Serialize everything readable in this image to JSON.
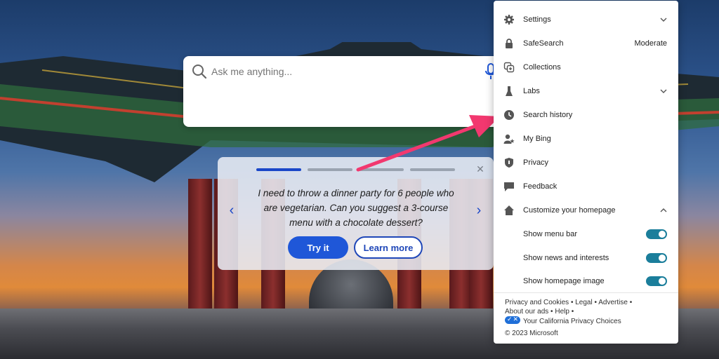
{
  "colors": {
    "accent": "#1f57d8",
    "toggle_on": "#1b7e9b",
    "arrow": "#f2386f"
  },
  "search": {
    "placeholder": "Ask me anything...",
    "icon": "search-icon",
    "mic_icon": "microphone-icon"
  },
  "suggestion": {
    "slides": 4,
    "active_slide": 1,
    "message": "I need to throw a dinner party for 6 people who are vegetarian. Can you suggest a 3-course menu with a chocolate dessert?",
    "try_label": "Try it",
    "learn_label": "Learn more",
    "prev_icon": "chevron-left-icon",
    "next_icon": "chevron-right-icon",
    "close_icon": "close-icon"
  },
  "menu": {
    "items": [
      {
        "label": "Settings",
        "icon": "gear-icon",
        "chevron": "down"
      },
      {
        "label": "SafeSearch",
        "icon": "lock-icon",
        "value": "Moderate"
      },
      {
        "label": "Collections",
        "icon": "collections-icon"
      },
      {
        "label": "Labs",
        "icon": "labs-icon",
        "chevron": "down"
      },
      {
        "label": "Search history",
        "icon": "clock-icon"
      },
      {
        "label": "My Bing",
        "icon": "user-star-icon"
      },
      {
        "label": "Privacy",
        "icon": "shield-icon"
      },
      {
        "label": "Feedback",
        "icon": "feedback-icon"
      },
      {
        "label": "Customize your homepage",
        "icon": "home-icon",
        "chevron": "up"
      }
    ],
    "toggles": [
      {
        "label": "Show menu bar",
        "on": true
      },
      {
        "label": "Show news and interests",
        "on": true
      },
      {
        "label": "Show homepage image",
        "on": true
      }
    ]
  },
  "footer": {
    "privacy_cookies": "Privacy and Cookies",
    "legal": "Legal",
    "advertise": "Advertise",
    "about_ads": "About our ads",
    "help": "Help",
    "sep": "•",
    "ca_privacy": "Your California Privacy Choices",
    "copyright": "© 2023 Microsoft"
  }
}
